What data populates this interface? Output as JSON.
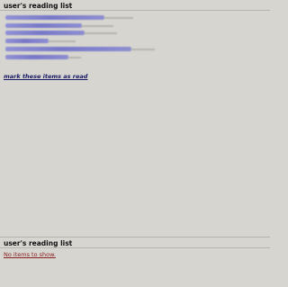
{
  "reading_list": {
    "title": "user's reading list",
    "mark_read_label": "mark these items as read"
  },
  "reading_list_bottom": {
    "title": "user's reading list",
    "empty_label": "No items to show."
  }
}
